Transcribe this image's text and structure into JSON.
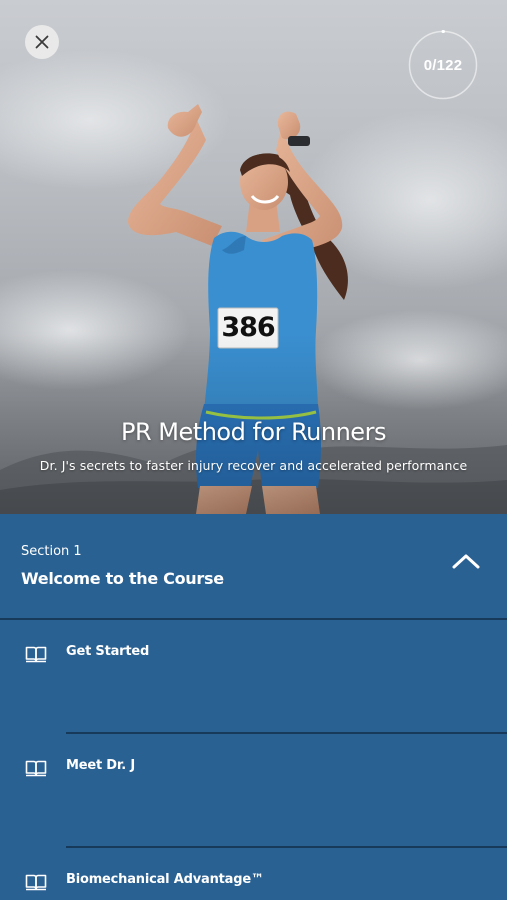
{
  "hero": {
    "title": "PR Method for Runners",
    "subtitle": "Dr. J's secrets to faster injury recover and accelerated performance",
    "bib_number": "386",
    "close_icon": "close-icon"
  },
  "progress": {
    "text": "0/122",
    "completed": 0,
    "total": 122
  },
  "section": {
    "label": "Section 1",
    "title": "Welcome to the Course",
    "toggle_icon": "chevron-up-icon",
    "expanded": true
  },
  "lessons": [
    {
      "label": "Get Started",
      "icon": "book-icon"
    },
    {
      "label": "Meet Dr. J",
      "icon": "book-icon"
    },
    {
      "label": "Biomechanical Advantage™",
      "icon": "book-icon"
    }
  ],
  "colors": {
    "accent": "#2a6193",
    "divider": "#173a5a",
    "text": "#ffffff"
  }
}
